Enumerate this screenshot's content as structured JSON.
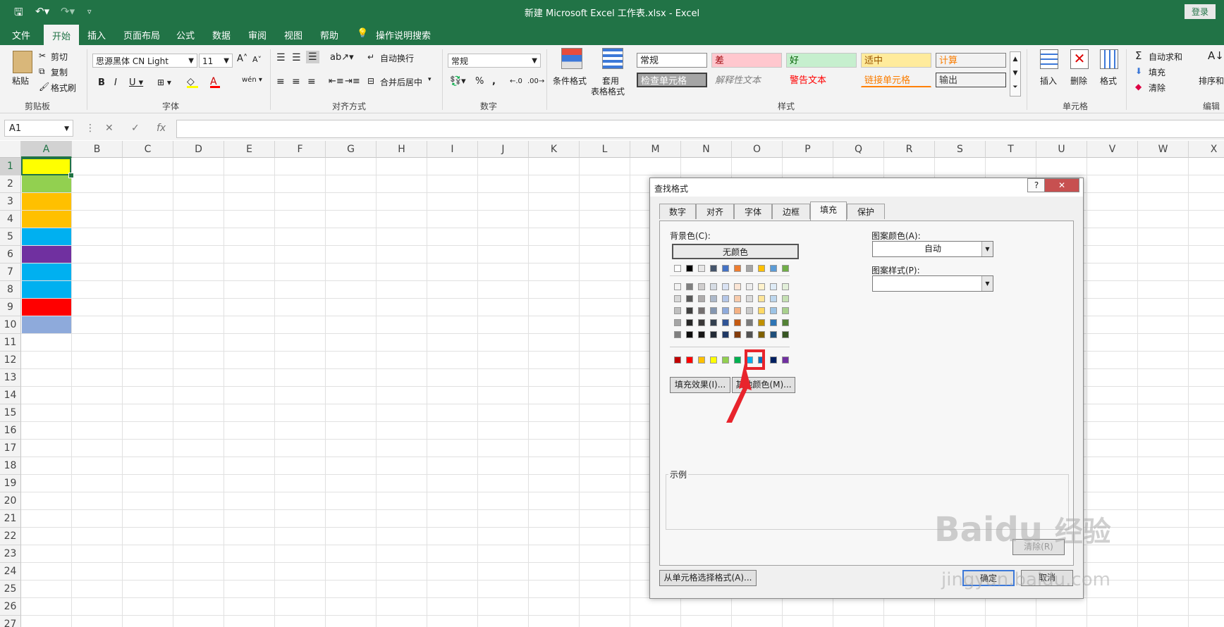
{
  "window": {
    "title": "新建 Microsoft Excel 工作表.xlsx  -  Excel",
    "login": "登录"
  },
  "ribbon_tabs": [
    "文件",
    "开始",
    "插入",
    "页面布局",
    "公式",
    "数据",
    "审阅",
    "视图",
    "帮助"
  ],
  "tell_me": "操作说明搜索",
  "clipboard": {
    "paste": "粘贴",
    "cut": "剪切",
    "copy": "复制",
    "format_painter": "格式刷",
    "group": "剪贴板"
  },
  "font": {
    "name": "思源黑体 CN Light",
    "size": "11",
    "group": "字体"
  },
  "alignment": {
    "wrap": "自动换行",
    "merge": "合并后居中",
    "group": "对齐方式"
  },
  "number": {
    "format": "常规",
    "group": "数字"
  },
  "styles": {
    "conditional": [
      "条件格式"
    ],
    "table": [
      "套用",
      "表格格式"
    ],
    "normal": "常规",
    "bad": "差",
    "good": "好",
    "neutral": "适中",
    "calc": "计算",
    "check": "检查单元格",
    "explain": "解释性文本",
    "warning": "警告文本",
    "linked": "链接单元格",
    "output": "输出",
    "group": "样式"
  },
  "cells": {
    "insert": "插入",
    "delete": "删除",
    "format": "格式",
    "group": "单元格"
  },
  "editing": {
    "autosum": "自动求和",
    "fill": "填充",
    "clear": "清除",
    "sort": "排序和",
    "group": "编辑"
  },
  "namebox": "A1",
  "columns": [
    "A",
    "B",
    "C",
    "D",
    "E",
    "F",
    "G",
    "H",
    "I",
    "J",
    "K",
    "L",
    "M",
    "N",
    "O",
    "P",
    "Q",
    "R",
    "S",
    "T",
    "U",
    "V",
    "W",
    "X"
  ],
  "rows": [
    "1",
    "2",
    "3",
    "4",
    "5",
    "6",
    "7",
    "8",
    "9",
    "10",
    "11",
    "12",
    "13",
    "14",
    "15",
    "16",
    "17",
    "18",
    "19",
    "20",
    "21",
    "22",
    "23",
    "24",
    "25",
    "26",
    "27"
  ],
  "fills": [
    "#ffff00",
    "#92d050",
    "#ffc000",
    "#ffc000",
    "#00b0f0",
    "#7030a0",
    "#00b0f0",
    "#00b0f0",
    "#ff0000",
    "#8eaadb"
  ],
  "dialog": {
    "title": "查找格式",
    "tabs": [
      "数字",
      "对齐",
      "字体",
      "边框",
      "填充",
      "保护"
    ],
    "bg_label": "背景色(C):",
    "no_color": "无颜色",
    "pattern_color_label": "图案颜色(A):",
    "pattern_color_value": "自动",
    "pattern_style_label": "图案样式(P):",
    "fill_effects": "填充效果(I)...",
    "more_colors": "其他颜色(M)...",
    "sample": "示例",
    "clear": "清除(R)",
    "from_cell": "从单元格选择格式(A)...",
    "ok": "确定",
    "cancel": "取消"
  },
  "palette": {
    "theme_top": [
      "#ffffff",
      "#000000",
      "#e7e6e6",
      "#44546a",
      "#4472c4",
      "#ed7d31",
      "#a5a5a5",
      "#ffc000",
      "#5b9bd5",
      "#70ad47"
    ],
    "tints": [
      [
        "#f2f2f2",
        "#7f7f7f",
        "#d0cece",
        "#d6dce4",
        "#d9e2f3",
        "#fbe5d5",
        "#ededed",
        "#fff2cc",
        "#deebf6",
        "#e2efd9"
      ],
      [
        "#d8d8d8",
        "#595959",
        "#aeabab",
        "#adb9ca",
        "#b4c6e7",
        "#f7cbac",
        "#dbdbdb",
        "#fee599",
        "#bdd7ee",
        "#c5e0b3"
      ],
      [
        "#bfbfbf",
        "#3f3f3f",
        "#757070",
        "#8496b0",
        "#8eaadb",
        "#f4b183",
        "#c9c9c9",
        "#ffd965",
        "#9cc3e5",
        "#a8d08d"
      ],
      [
        "#a5a5a5",
        "#262626",
        "#3a3838",
        "#323f4f",
        "#2f5496",
        "#c55a11",
        "#7b7b7b",
        "#bf9000",
        "#2e75b5",
        "#538135"
      ],
      [
        "#7f7f7f",
        "#0c0c0c",
        "#171616",
        "#222a35",
        "#1f3864",
        "#833c0b",
        "#525252",
        "#7f6000",
        "#1e4e79",
        "#375623"
      ]
    ],
    "standard": [
      "#c00000",
      "#ff0000",
      "#ffc000",
      "#ffff00",
      "#92d050",
      "#00b050",
      "#00b0f0",
      "#0070c0",
      "#002060",
      "#7030a0"
    ]
  },
  "accent": {
    "excel_green": "#217346",
    "highlight_red": "#e8242c"
  },
  "watermark": [
    "Bai",
    "du",
    "经验",
    "jingyan.baidu.com"
  ]
}
